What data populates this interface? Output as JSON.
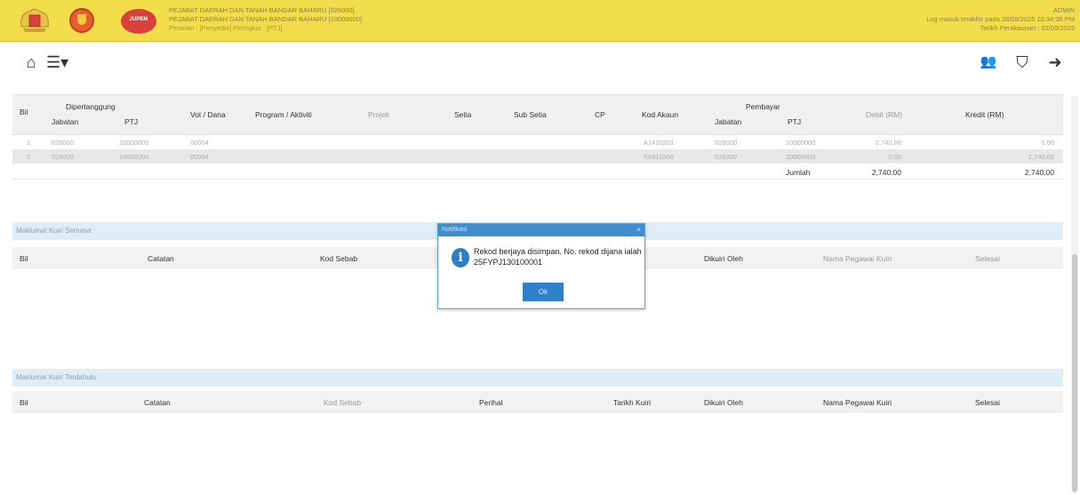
{
  "header": {
    "line1": "PEJABAT DAERAH DAN TANAH BANDAR BAHARU [026000]",
    "line2": "PEJABAT DAERAH DAN TANAH BANDAR BAHARU [10000000]",
    "line3": "Peranan : [Penyedia] Peringkat : [PTJ]",
    "user": "ADMIN",
    "last_login": "Log masuk terakhir pada 28/08/2025 10:34:38 PM",
    "account_date": "Tarikh Perakaunan : 02/09/2025",
    "jupem_text": "JUPEM"
  },
  "toolbar": {
    "home_glyph": "⌂",
    "menu_glyph": "☰▾",
    "person_glyph": "👥",
    "shield_glyph": "⛉",
    "logout_glyph": "➜"
  },
  "journal": {
    "headers": {
      "bil": "Bil",
      "ditanggung": "Dipertanggung",
      "jabatan": "Jabatan",
      "ptj": "PTJ",
      "vot": "Vot / Dana",
      "program": "Program / Aktiviti",
      "projek": "Projek",
      "setia": "Setia",
      "subsetia": "Sub Setia",
      "cp": "CP",
      "kod_akaun": "Kod Akaun",
      "pembayar": "Pembayar",
      "p_jabatan": "Jabatan",
      "p_ptj": "PTJ",
      "debit": "Debit (RM)",
      "kredit": "Kredit (RM)"
    },
    "rows": [
      {
        "bil": "1",
        "jabatan": "026000",
        "ptj": "10000000",
        "vot": "00004",
        "kod": "A1420201",
        "p_jabatan": "026000",
        "p_ptj": "10000000",
        "debit": "2,740.00",
        "kredit": "0.00"
      },
      {
        "bil": "2",
        "jabatan": "026000",
        "ptj": "10000000",
        "vot": "00004",
        "kod": "E0311006",
        "p_jabatan": "026000",
        "p_ptj": "10000000",
        "debit": "0.00",
        "kredit": "2,740.00"
      }
    ],
    "total_label": "Jumlah",
    "total_debit": "2,740.00",
    "total_kredit": "2,740.00"
  },
  "query_current": {
    "title": "Maklumat Kuiri Semasa",
    "headers": {
      "bil": "Bil",
      "catatan": "Catatan",
      "kod_sebab": "Kod Sebab",
      "dikuiri": "Dikuiri Oleh",
      "nama": "Nama Pegawai Kuiri",
      "selesai": "Selesai"
    }
  },
  "query_previous": {
    "title": "Maklumat Kuiri Terdahulu",
    "headers": {
      "bil": "Bil",
      "catatan": "Catatan",
      "kod_sebab": "Kod Sebab",
      "perihal": "Perihal",
      "tarikh": "Tarikh Kuiri",
      "dikuiri": "Dikuiri Oleh",
      "nama": "Nama Pegawai Kuiri",
      "selesai": "Selesai"
    }
  },
  "dialog": {
    "title": "Notifikasi",
    "close": "×",
    "icon_glyph": "i",
    "message": "Rekod berjaya disimpan. No. rekod dijana ialah 25FYPJ130100001",
    "ok_label": "Ok"
  }
}
